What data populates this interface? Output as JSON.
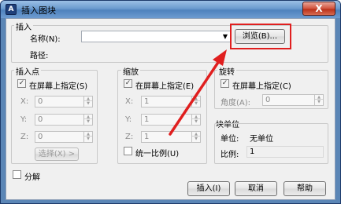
{
  "window": {
    "title": "插入图块",
    "close": "X",
    "app_icon": "A"
  },
  "insert_group": {
    "label": "插入",
    "name_label": "名称(N):",
    "name_value": "",
    "browse_button": "浏览(B)...",
    "path_label": "路径:"
  },
  "insertion_point": {
    "label": "插入点",
    "specify_on_screen": "在屏幕上指定(S)",
    "x_label": "X:",
    "x_value": "0",
    "y_label": "Y:",
    "y_value": "0",
    "z_label": "Z:",
    "z_value": "0",
    "pick_button": "选择(X) >"
  },
  "scale": {
    "label": "缩放",
    "specify_on_screen": "在屏幕上指定(E)",
    "x_label": "X:",
    "x_value": "1",
    "y_label": "Y:",
    "y_value": "1",
    "z_label": "Z:",
    "z_value": "1",
    "uniform_scale": "统一比例(U)"
  },
  "rotation": {
    "label": "旋转",
    "specify_on_screen": "在屏幕上指定(C)",
    "angle_label": "角度(A):",
    "angle_value": "0"
  },
  "block_unit": {
    "label": "块单位",
    "unit_label": "单位:",
    "unit_value": "无单位",
    "factor_label": "比例:",
    "factor_value": "1"
  },
  "explode": "分解",
  "buttons": {
    "insert": "插入(I)",
    "cancel": "取消",
    "help": "帮助"
  },
  "colors": {
    "highlight": "#e01f1f",
    "title_bar": "#6b9bcf"
  }
}
